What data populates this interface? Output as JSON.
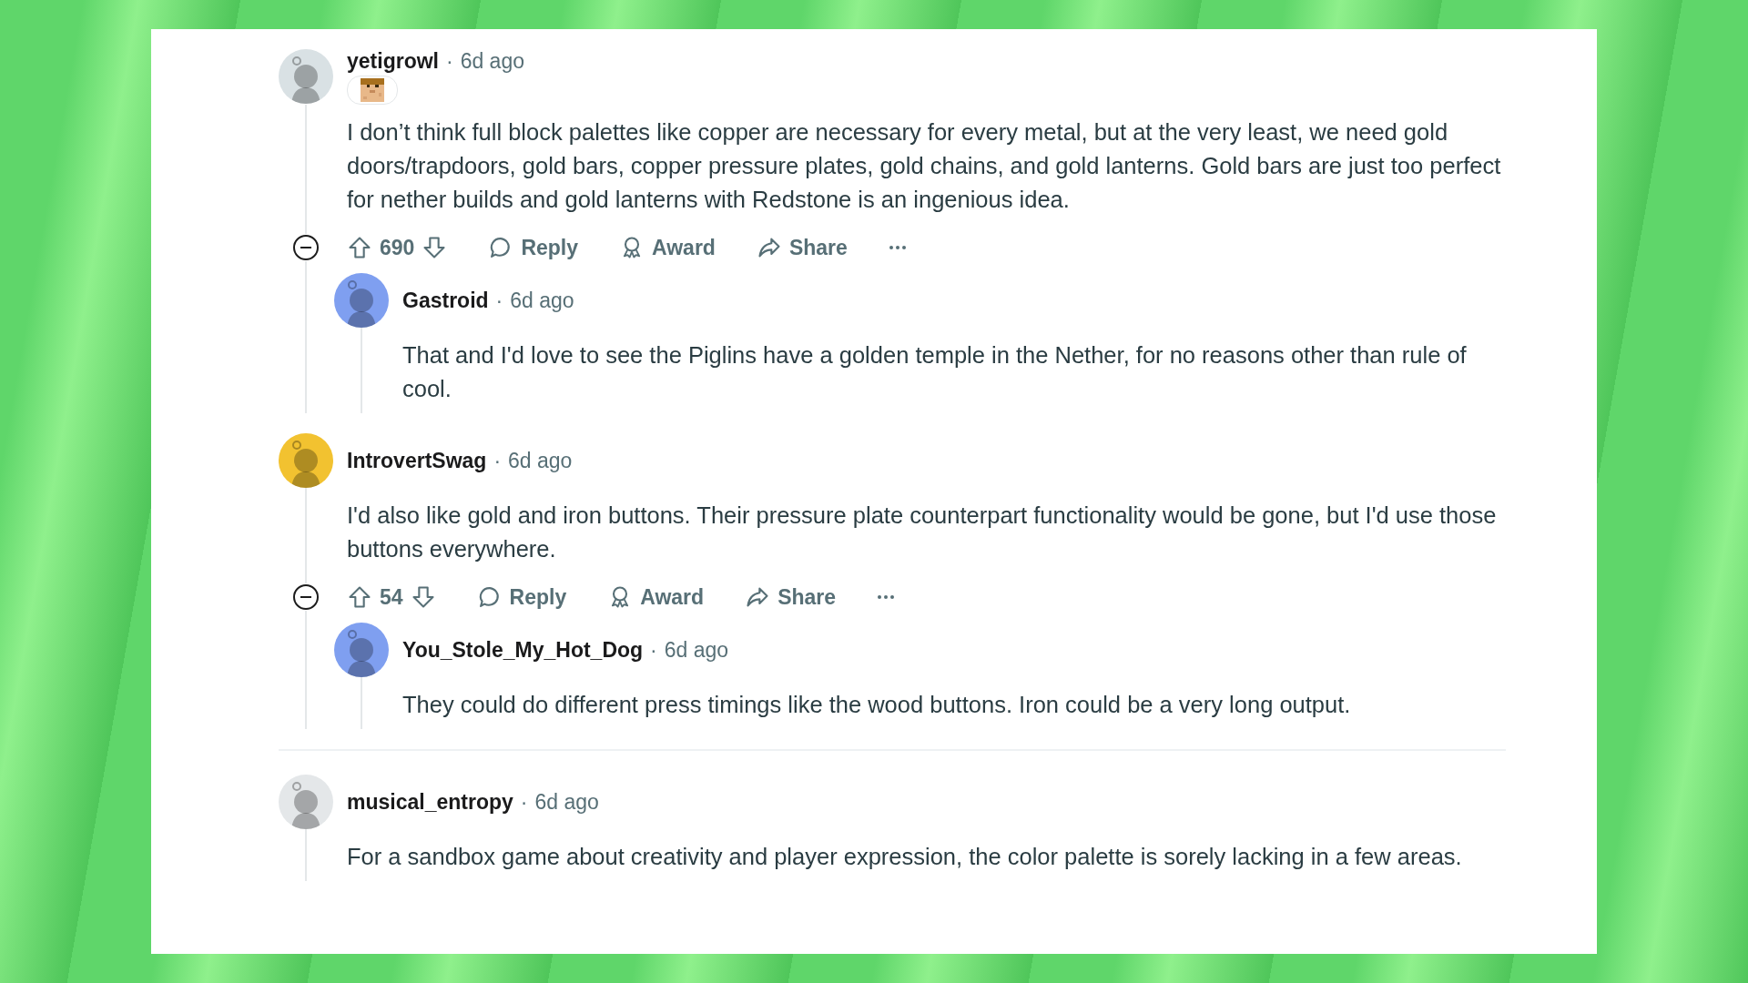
{
  "sections": [
    {
      "comments": [
        {
          "author": "yetigrowl",
          "separator": "·",
          "time": "6d ago",
          "color": "#d9e1e4",
          "flair": true,
          "body": "I don’t think full block palettes like copper are necessary for every metal, but at the very least, we need gold doors/trapdoors, gold bars, copper pressure plates, gold chains, and gold lanterns. Gold bars are just too perfect for nether builds and gold lanterns with Redstone is an ingenious idea.",
          "actions": {
            "score": "690",
            "reply": "Reply",
            "award": "Award",
            "share": "Share"
          },
          "children": [
            {
              "author": "Gastroid",
              "separator": "·",
              "time": "6d ago",
              "color": "#7f9ff0",
              "body": "That and I'd love to see the Piglins have a golden temple in the Nether, for no reasons other than rule of cool."
            }
          ]
        },
        {
          "author": "IntrovertSwag",
          "separator": "·",
          "time": "6d ago",
          "color": "#f2c230",
          "body": "I'd also like gold and iron buttons. Their pressure plate counterpart functionality would be gone, but I'd use those buttons everywhere.",
          "actions": {
            "score": "54",
            "reply": "Reply",
            "award": "Award",
            "share": "Share"
          },
          "children": [
            {
              "author": "You_Stole_My_Hot_Dog",
              "separator": "·",
              "time": "6d ago",
              "color": "#7f9ff0",
              "body": "They could do different press timings like the wood buttons. Iron could be a very long output."
            }
          ]
        }
      ]
    },
    {
      "comments": [
        {
          "author": "musical_entropy",
          "separator": "·",
          "time": "6d ago",
          "color": "#e4e7e9",
          "body": "For a sandbox game about creativity and player expression, the color palette is sorely lacking in a few areas."
        }
      ]
    }
  ]
}
